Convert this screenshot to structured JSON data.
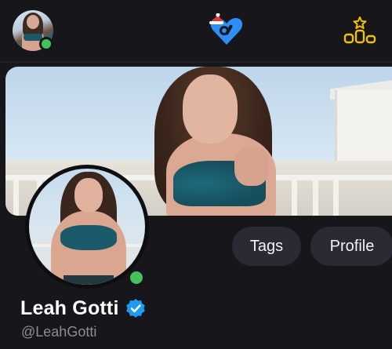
{
  "header": {
    "avatar_alt": "user avatar",
    "logo_icon": "heart-logo-with-santa-hat-icon",
    "leaderboard_icon": "podium-star-icon"
  },
  "profile": {
    "display_name": "Leah Gotti",
    "handle": "@LeahGotti",
    "verified": true,
    "online": true
  },
  "actions": {
    "tags_label": "Tags",
    "profile_label": "Profile"
  },
  "colors": {
    "background": "#16161b",
    "pill_bg": "#292a33",
    "online_green": "#44c15a",
    "verified_blue": "#1d9bf0",
    "accent_yellow": "#f2c200",
    "logo_blue": "#2f8df7",
    "handle_gray": "#8c8d96"
  }
}
